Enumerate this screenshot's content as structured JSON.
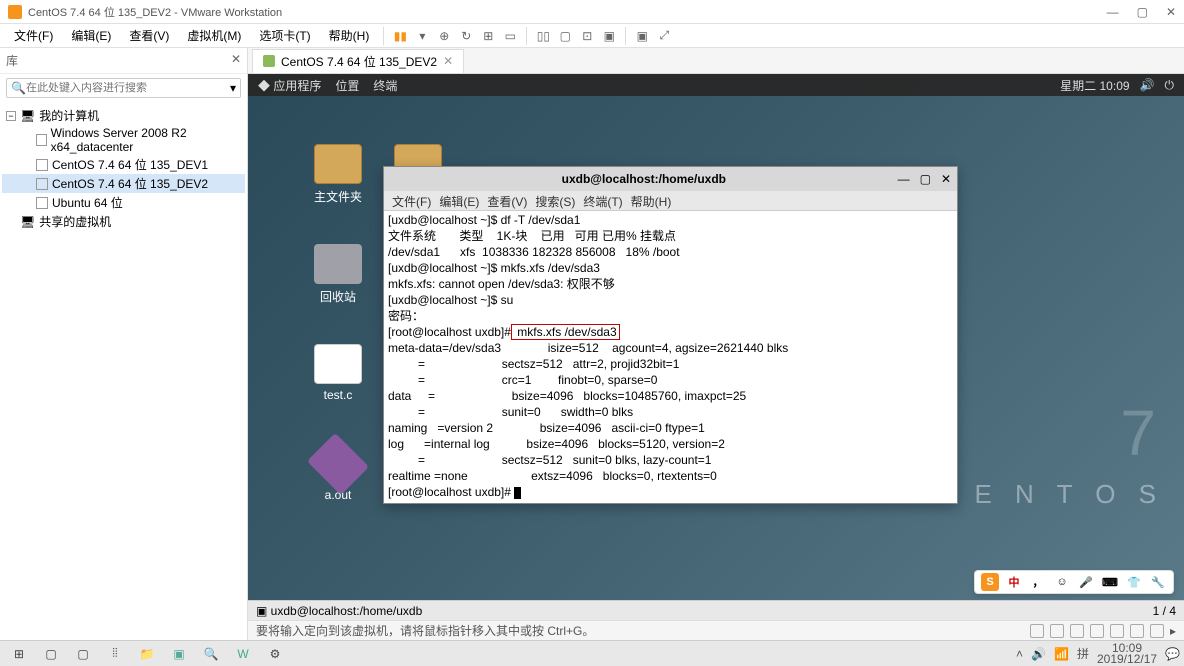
{
  "vmware": {
    "title": "CentOS 7.4 64 位 135_DEV2 - VMware Workstation",
    "menu": [
      "文件(F)",
      "编辑(E)",
      "查看(V)",
      "虚拟机(M)",
      "选项卡(T)",
      "帮助(H)"
    ]
  },
  "library": {
    "header": "库",
    "search_placeholder": "在此处键入内容进行搜索",
    "root": "我的计算机",
    "vms": [
      "Windows Server 2008 R2 x64_datacenter",
      "CentOS 7.4 64 位 135_DEV1",
      "CentOS 7.4 64 位 135_DEV2",
      "Ubuntu 64 位"
    ],
    "shared": "共享的虚拟机"
  },
  "tab": {
    "label": "CentOS 7.4 64 位 135_DEV2"
  },
  "gnome": {
    "apps": "应用程序",
    "places": "位置",
    "term": "终端",
    "clock": "星期二 10:09"
  },
  "icons": {
    "home": "主文件夹",
    "trash": "回收站",
    "file1": "test.c",
    "file2": "a.out"
  },
  "terminal": {
    "title": "uxdb@localhost:/home/uxdb",
    "menu": [
      "文件(F)",
      "编辑(E)",
      "查看(V)",
      "搜索(S)",
      "终端(T)",
      "帮助(H)"
    ],
    "l1": "[uxdb@localhost ~]$ df -T /dev/sda1",
    "l2": "文件系统       类型    1K-块    已用   可用 已用% 挂载点",
    "l3": "/dev/sda1      xfs  1038336 182328 856008   18% /boot",
    "l4": "[uxdb@localhost ~]$ mkfs.xfs /dev/sda3",
    "l5": "mkfs.xfs: cannot open /dev/sda3: 权限不够",
    "l6": "[uxdb@localhost ~]$ su",
    "l7": "密码：",
    "l8a": "[root@localhost uxdb]#",
    "l8b": " mkfs.xfs /dev/sda3",
    "l9": "meta-data=/dev/sda3              isize=512    agcount=4, agsize=2621440 blks",
    "l10": "         =                       sectsz=512   attr=2, projid32bit=1",
    "l11": "         =                       crc=1        finobt=0, sparse=0",
    "l12": "data     =                       bsize=4096   blocks=10485760, imaxpct=25",
    "l13": "         =                       sunit=0      swidth=0 blks",
    "l14": "naming   =version 2              bsize=4096   ascii-ci=0 ftype=1",
    "l15": "log      =internal log           bsize=4096   blocks=5120, version=2",
    "l16": "         =                       sectsz=512   sunit=0 blks, lazy-count=1",
    "l17": "realtime =none                   extsz=4096   blocks=0, rtextents=0",
    "l18": "[root@localhost uxdb]# "
  },
  "guest_task": "uxdb@localhost:/home/uxdb",
  "guest_task_right": "1 / 4",
  "status": "要将输入定向到该虚拟机，请将鼠标指针移入其中或按 Ctrl+G。",
  "centos": "C E N T O S",
  "ime": {
    "s": "S",
    "zhong": "中"
  },
  "win_clock": {
    "time": "10:09",
    "date": "2019/12/17"
  }
}
